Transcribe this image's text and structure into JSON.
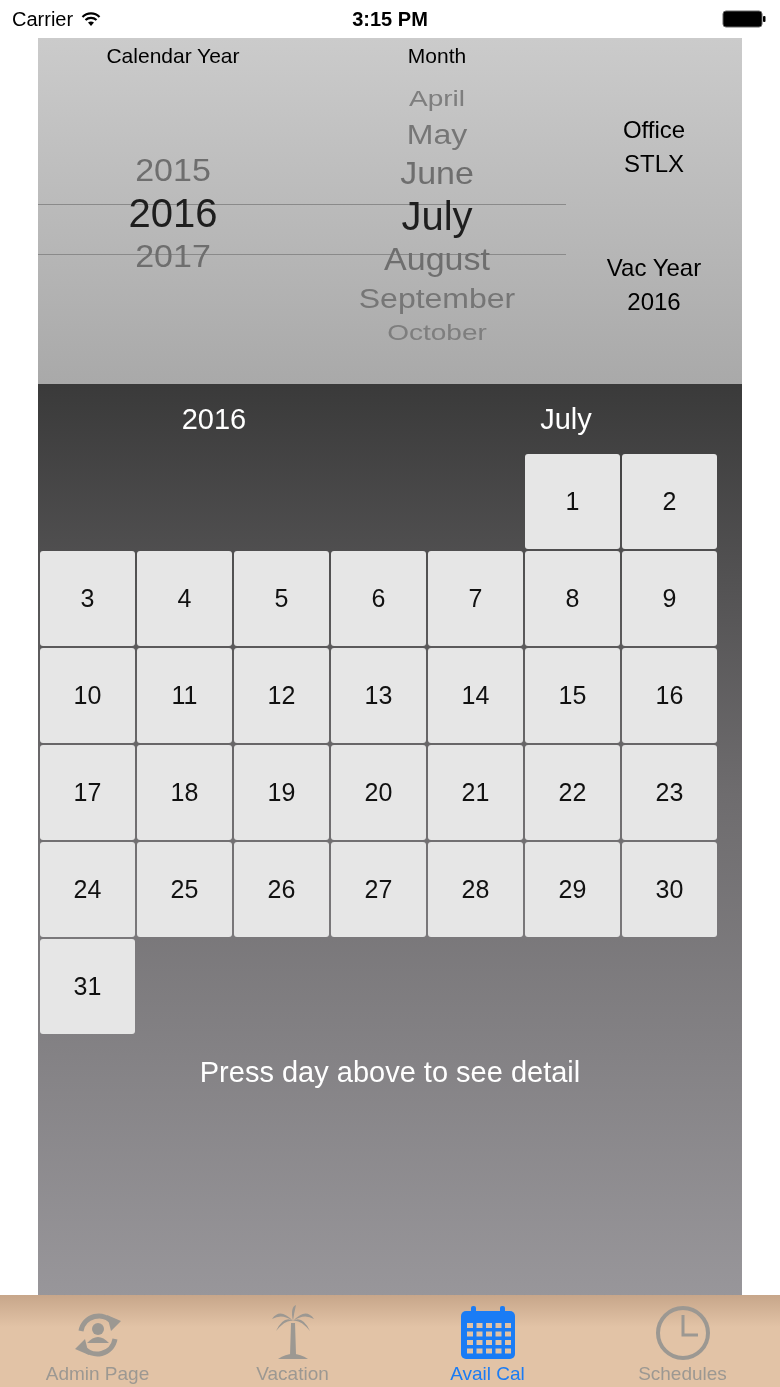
{
  "status_bar": {
    "carrier": "Carrier",
    "time": "3:15 PM"
  },
  "picker": {
    "year_heading": "Calendar Year",
    "month_heading": "Month",
    "years": [
      {
        "label": "2015",
        "selected": false
      },
      {
        "label": "2016",
        "selected": true
      },
      {
        "label": "2017",
        "selected": false
      }
    ],
    "months": [
      {
        "label": "April",
        "selected": false
      },
      {
        "label": "May",
        "selected": false
      },
      {
        "label": "June",
        "selected": false
      },
      {
        "label": "July",
        "selected": true
      },
      {
        "label": "August",
        "selected": false
      },
      {
        "label": "September",
        "selected": false
      },
      {
        "label": "October",
        "selected": false
      }
    ]
  },
  "office": {
    "label": "Office",
    "value": "STLX"
  },
  "vac_year": {
    "label": "Vac Year",
    "value": "2016"
  },
  "calendar": {
    "year": "2016",
    "month": "July",
    "cells": [
      {
        "kind": "blank"
      },
      {
        "kind": "blank"
      },
      {
        "kind": "blank"
      },
      {
        "kind": "blank"
      },
      {
        "kind": "blank"
      },
      {
        "kind": "day",
        "label": "1"
      },
      {
        "kind": "day",
        "label": "2"
      },
      {
        "kind": "day",
        "label": "3"
      },
      {
        "kind": "day",
        "label": "4"
      },
      {
        "kind": "day",
        "label": "5"
      },
      {
        "kind": "day",
        "label": "6"
      },
      {
        "kind": "day",
        "label": "7"
      },
      {
        "kind": "day",
        "label": "8"
      },
      {
        "kind": "day",
        "label": "9"
      },
      {
        "kind": "day",
        "label": "10"
      },
      {
        "kind": "day",
        "label": "11"
      },
      {
        "kind": "day",
        "label": "12"
      },
      {
        "kind": "day",
        "label": "13"
      },
      {
        "kind": "day",
        "label": "14"
      },
      {
        "kind": "day",
        "label": "15"
      },
      {
        "kind": "day",
        "label": "16"
      },
      {
        "kind": "day",
        "label": "17"
      },
      {
        "kind": "day",
        "label": "18"
      },
      {
        "kind": "day",
        "label": "19"
      },
      {
        "kind": "day",
        "label": "20"
      },
      {
        "kind": "day",
        "label": "21"
      },
      {
        "kind": "day",
        "label": "22"
      },
      {
        "kind": "day",
        "label": "23"
      },
      {
        "kind": "day",
        "label": "24"
      },
      {
        "kind": "day",
        "label": "25"
      },
      {
        "kind": "day",
        "label": "26"
      },
      {
        "kind": "day",
        "label": "27"
      },
      {
        "kind": "day",
        "label": "28"
      },
      {
        "kind": "day",
        "label": "29"
      },
      {
        "kind": "day",
        "label": "30"
      },
      {
        "kind": "day",
        "label": "31"
      }
    ],
    "hint": "Press day above to see detail"
  },
  "tab_bar": [
    {
      "kind": "admin",
      "label": "Admin Page",
      "selected": false
    },
    {
      "kind": "vacation",
      "label": "Vacation",
      "selected": false
    },
    {
      "kind": "calendar",
      "label": "Avail Cal",
      "selected": true
    },
    {
      "kind": "schedules",
      "label": "Schedules",
      "selected": false
    }
  ]
}
